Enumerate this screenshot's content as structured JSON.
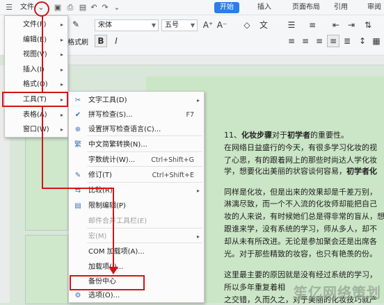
{
  "topbar": {
    "menu_icon": "hamburger-icon",
    "file_label": "文件",
    "quick_icons": [
      "save-icon",
      "print-icon",
      "print-preview-icon",
      "undo-icon",
      "redo-icon",
      "more-icon"
    ],
    "tabs": [
      "开始",
      "插入",
      "页面布局",
      "引用",
      "审阅"
    ]
  },
  "ribbon": {
    "format_painter_label": "格式刷",
    "font_name": "宋体",
    "font_size": "五号",
    "bold": "B",
    "italic": "I"
  },
  "file_menu": {
    "items": [
      {
        "label": "文件(F)"
      },
      {
        "label": "编辑(E)"
      },
      {
        "label": "视图(V)"
      },
      {
        "label": "插入(I)"
      },
      {
        "label": "格式(O)"
      },
      {
        "label": "工具(T)"
      },
      {
        "label": "表格(A)"
      },
      {
        "label": "窗口(W)"
      }
    ]
  },
  "tools_menu": {
    "items": [
      {
        "label": "文字工具(D)",
        "icon": "text-tool-icon",
        "shortcut": "",
        "submenu": true,
        "disabled": false
      },
      {
        "label": "拼写检查(S)...",
        "icon": "spell-check-icon",
        "shortcut": "F7",
        "submenu": false,
        "disabled": false
      },
      {
        "label": "设置拼写检查语言(C)...",
        "icon": "globe-icon",
        "shortcut": "",
        "submenu": false,
        "disabled": false
      },
      {
        "label": "中文简繁转换(N)...",
        "icon": "convert-icon",
        "shortcut": "",
        "submenu": false,
        "disabled": false
      },
      {
        "label": "字数统计(W)...",
        "icon": "",
        "shortcut": "Ctrl+Shift+G",
        "submenu": false,
        "disabled": false
      },
      {
        "label": "修订(T)",
        "icon": "revision-icon",
        "shortcut": "Ctrl+Shift+E",
        "submenu": false,
        "disabled": false
      },
      {
        "label": "比较(R)",
        "icon": "compare-icon",
        "shortcut": "",
        "submenu": true,
        "disabled": false
      },
      {
        "label": "限制编辑(P)",
        "icon": "restrict-icon",
        "shortcut": "",
        "submenu": false,
        "disabled": false
      },
      {
        "label": "邮件合并工具栏(E)",
        "icon": "",
        "shortcut": "",
        "submenu": false,
        "disabled": true
      },
      {
        "label": "宏(M)",
        "icon": "",
        "shortcut": "",
        "submenu": true,
        "disabled": true
      },
      {
        "label": "COM 加载项(A)...",
        "icon": "",
        "shortcut": "",
        "submenu": false,
        "disabled": false
      },
      {
        "label": "加载项(I)...",
        "icon": "",
        "shortcut": "",
        "submenu": false,
        "disabled": false
      },
      {
        "label": "备份中心",
        "icon": "",
        "shortcut": "",
        "submenu": false,
        "disabled": false
      },
      {
        "label": "选项(O)...",
        "icon": "gear-icon",
        "shortcut": "",
        "submenu": false,
        "disabled": false
      }
    ]
  },
  "document": {
    "lines": [
      {
        "pre": "11、",
        "bold": "化妆步骤",
        "mid": "对于",
        "bold2": "初学者",
        "post": "的重要性。"
      },
      {
        "pre": "在网络日益盛行的今天，有很多学习化妆的视",
        "bold": "",
        "mid": "",
        "bold2": "",
        "post": ""
      },
      {
        "pre": "了心思，有的跟着网上的那些时尚达人学化妆",
        "bold": "",
        "mid": "",
        "bold2": "",
        "post": ""
      },
      {
        "pre": "学，想要化出美丽的状容谈何容易，",
        "bold": "初学者化",
        "mid": "",
        "bold2": "",
        "post": ""
      },
      {
        "pre": "同样是化妆，但是出来的效果却是千差万别，",
        "bold": "",
        "mid": "",
        "bold2": "",
        "post": ""
      },
      {
        "pre": "淋漓尽致，而一个不入流的化妆师却能把自己",
        "bold": "",
        "mid": "",
        "bold2": "",
        "post": ""
      },
      {
        "pre": "妆的人来说，有时候她们总是得非常的盲从，想",
        "bold": "",
        "mid": "",
        "bold2": "",
        "post": ""
      },
      {
        "pre": "跟谁来学，没有系统的学习，师从多人，却不",
        "bold": "",
        "mid": "",
        "bold2": "",
        "post": ""
      },
      {
        "pre": "却从未有所改进。无论是参加聚会还是出席各",
        "bold": "",
        "mid": "",
        "bold2": "",
        "post": ""
      },
      {
        "pre": "光。对于那些精致的妆容，也只有艳羡的份。",
        "bold": "",
        "mid": "",
        "bold2": "",
        "post": ""
      },
      {
        "pre": "这里最主要的原因就是没有经过系统的学习，",
        "bold": "",
        "mid": "",
        "bold2": "",
        "post": ""
      },
      {
        "pre": "所以多年重复着相",
        "bold": "",
        "mid": "",
        "bold2": "",
        "post": ""
      },
      {
        "pre": "之交错，久而久之，对于美丽的化妆技巧就产",
        "bold": "",
        "mid": "",
        "bold2": "",
        "post": ""
      }
    ]
  },
  "watermark": "笙亿网络策划"
}
